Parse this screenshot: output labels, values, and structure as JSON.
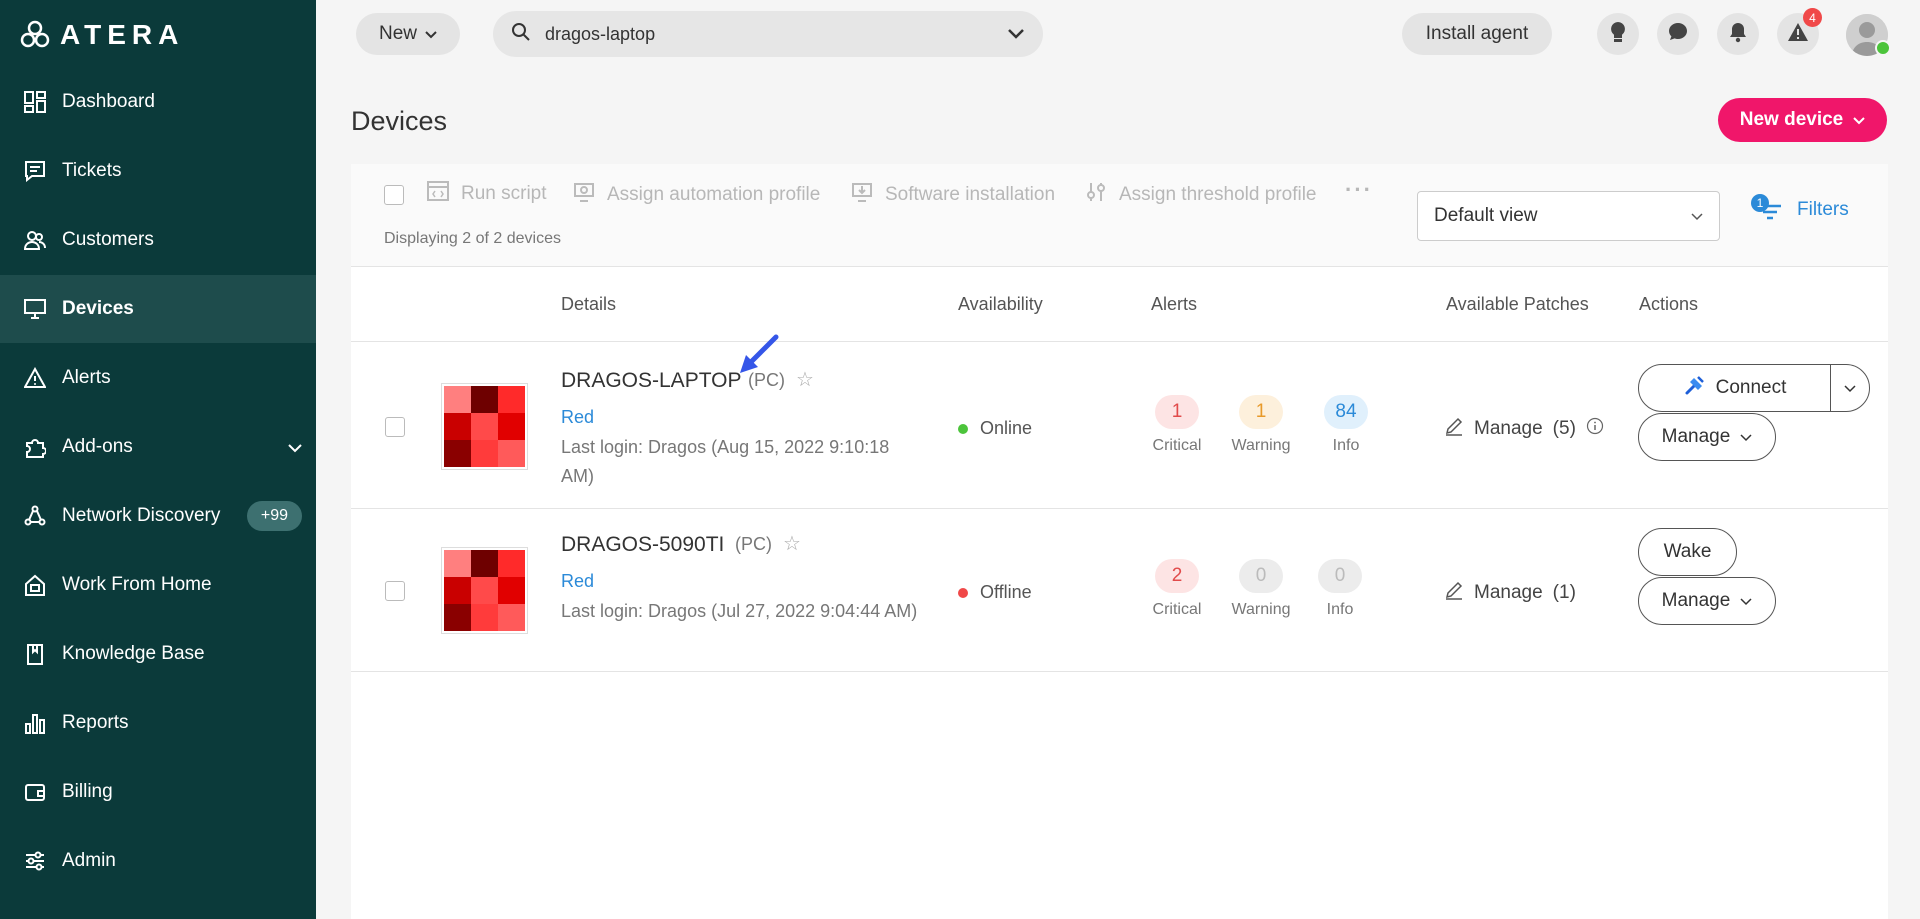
{
  "brand": {
    "logo_text": "ATERA"
  },
  "sidebar": {
    "items": [
      {
        "label": "Dashboard",
        "icon": "dashboard-icon"
      },
      {
        "label": "Tickets",
        "icon": "tickets-icon"
      },
      {
        "label": "Customers",
        "icon": "customers-icon"
      },
      {
        "label": "Devices",
        "icon": "devices-icon",
        "active": true
      },
      {
        "label": "Alerts",
        "icon": "alerts-icon"
      },
      {
        "label": "Add-ons",
        "icon": "addons-icon",
        "expandable": true
      },
      {
        "label": "Network Discovery",
        "icon": "network-discovery-icon",
        "badge": "+99"
      },
      {
        "label": "Work From Home",
        "icon": "work-from-home-icon"
      },
      {
        "label": "Knowledge Base",
        "icon": "knowledge-base-icon"
      },
      {
        "label": "Reports",
        "icon": "reports-icon"
      },
      {
        "label": "Billing",
        "icon": "billing-icon"
      },
      {
        "label": "Admin",
        "icon": "admin-icon"
      }
    ]
  },
  "topbar": {
    "new_label": "New",
    "search_value": "dragos-laptop",
    "install_agent_label": "Install agent",
    "alerts_badge": "4"
  },
  "page": {
    "title": "Devices",
    "new_device_label": "New device"
  },
  "toolbar": {
    "run_script": "Run script",
    "assign_automation": "Assign automation profile",
    "software_installation": "Software installation",
    "assign_threshold": "Assign threshold profile",
    "more": "···",
    "displaying": "Displaying 2 of 2 devices",
    "view_select": "Default view",
    "filters_label": "Filters",
    "filters_count": "1"
  },
  "table": {
    "headers": {
      "details": "Details",
      "availability": "Availability",
      "alerts": "Alerts",
      "patches": "Available Patches",
      "actions": "Actions"
    },
    "rows": [
      {
        "name": "DRAGOS-LAPTOP",
        "type": "(PC)",
        "customer": "Red",
        "last_login": "Last login: Dragos (Aug 15, 2022 9:10:18 AM)",
        "status": "Online",
        "status_color": "#4cc43b",
        "critical": "1",
        "warning": "1",
        "info": "84",
        "critical_label": "Critical",
        "warning_label": "Warning",
        "info_label": "Info",
        "patches_label": "Manage",
        "patches_count": "(5)",
        "primary_action": "Connect",
        "manage_label": "Manage"
      },
      {
        "name": "DRAGOS-5090TI",
        "type": "(PC)",
        "customer": "Red",
        "last_login": "Last login: Dragos (Jul 27, 2022 9:04:44 AM)",
        "status": "Offline",
        "status_color": "#f04848",
        "critical": "2",
        "warning": "0",
        "info": "0",
        "critical_label": "Critical",
        "warning_label": "Warning",
        "info_label": "Info",
        "patches_label": "Manage",
        "patches_count": "(1)",
        "primary_action": "Wake",
        "manage_label": "Manage"
      }
    ]
  },
  "colors": {
    "sidebar_bg": "#0b3a3a",
    "accent_pink": "#f0166a",
    "link_blue": "#2b8ad8"
  }
}
